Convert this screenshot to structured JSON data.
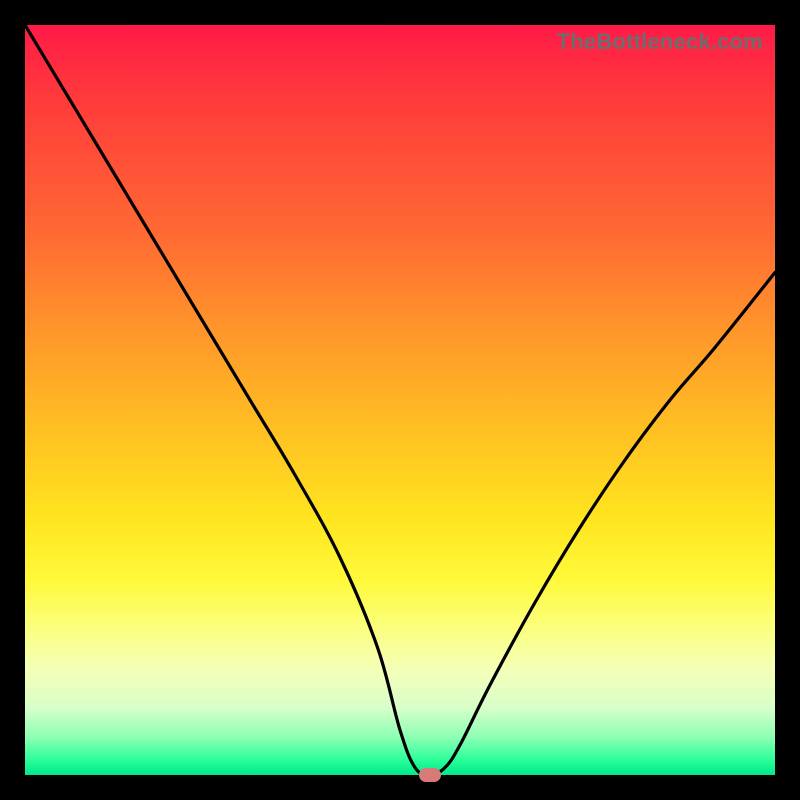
{
  "watermark": "TheBottleneck.com",
  "colors": {
    "frame": "#000000",
    "curve": "#000000",
    "marker": "#d87a78",
    "gradient_top": "#ff1a47",
    "gradient_bottom": "#00e88a"
  },
  "chart_data": {
    "type": "line",
    "title": "",
    "xlabel": "",
    "ylabel": "",
    "xlim": [
      0,
      100
    ],
    "ylim": [
      0,
      100
    ],
    "grid": false,
    "legend": false,
    "series": [
      {
        "name": "bottleneck-curve",
        "x": [
          0,
          6,
          12,
          18,
          24,
          30,
          36,
          42,
          47,
          50,
          52,
          54,
          56,
          58,
          62,
          68,
          74,
          80,
          86,
          92,
          100
        ],
        "values": [
          100,
          90,
          80,
          70,
          60,
          50,
          40,
          29,
          17,
          6,
          1,
          0,
          1,
          4,
          12,
          23,
          33,
          42,
          50,
          57,
          67
        ]
      }
    ],
    "annotations": [
      {
        "name": "optimal-marker",
        "x": 54,
        "y": 0,
        "shape": "pill",
        "color": "#d87a78"
      }
    ]
  }
}
